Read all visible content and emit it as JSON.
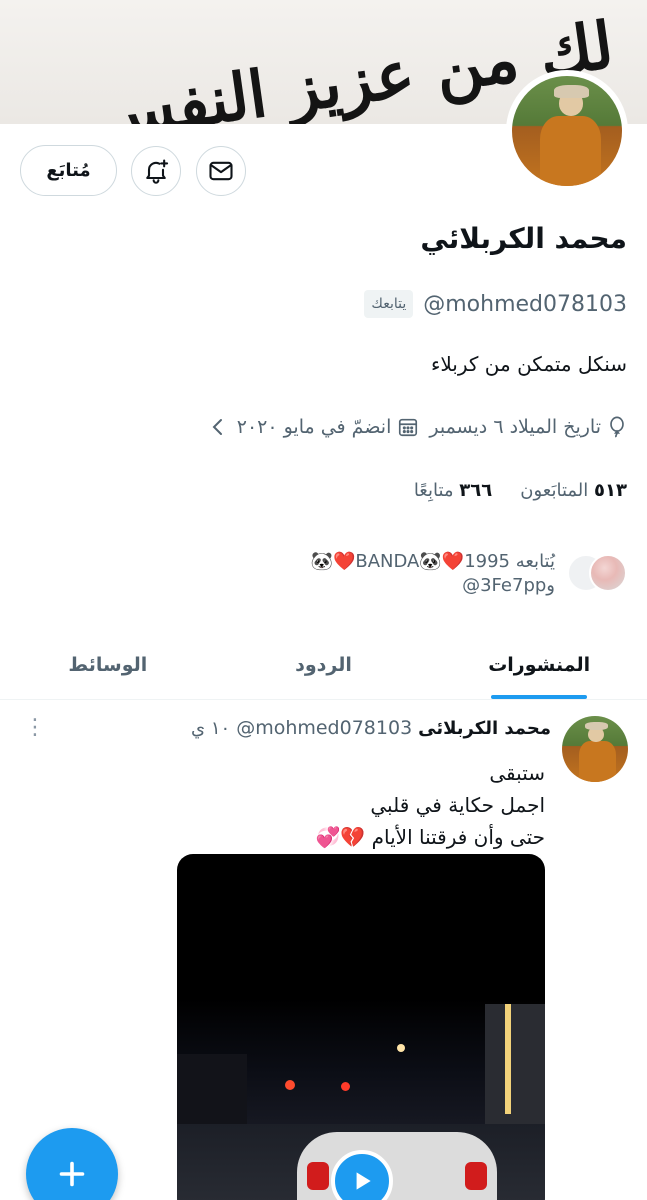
{
  "banner": {
    "calligraphy": "لك من عزيز النفس"
  },
  "header_actions": {
    "follow_label": "مُتابَع",
    "message_icon": "mail-icon",
    "notify_icon": "bell-plus-icon"
  },
  "profile": {
    "name": "محمد الكربلائي",
    "handle": "@mohmed078103",
    "follows_you": "يتابعك",
    "bio": "سنكل متمكن من كربلاء",
    "birthday": "تاريخ الميلاد ٦ ديسمبر",
    "joined": "انضمّ في مايو ٢٠٢٠",
    "following_count": "٥١٣",
    "following_label": "المتابَعون",
    "followers_count": "٣٦٦",
    "followers_label": "متابِعًا",
    "followed_by_line1": "يُتابعه 1995❤️🐼BANDA❤️🐼",
    "followed_by_line2": "و3Fe7pp@"
  },
  "tabs": [
    {
      "label": "المنشورات",
      "active": true
    },
    {
      "label": "الردود",
      "active": false
    },
    {
      "label": "الوسائط",
      "active": false
    }
  ],
  "tweet": {
    "name": "محمد الكربلائى",
    "handle": "@mohmed078103",
    "time": "١٠ ي",
    "lines": [
      "ستبقى",
      "اجمل حكاية في قلبي",
      "حتى وأن فرقتنا الأيام 💔💞"
    ]
  },
  "colors": {
    "accent": "#1d9bf0",
    "muted": "#536471",
    "border": "#cfd9de"
  }
}
